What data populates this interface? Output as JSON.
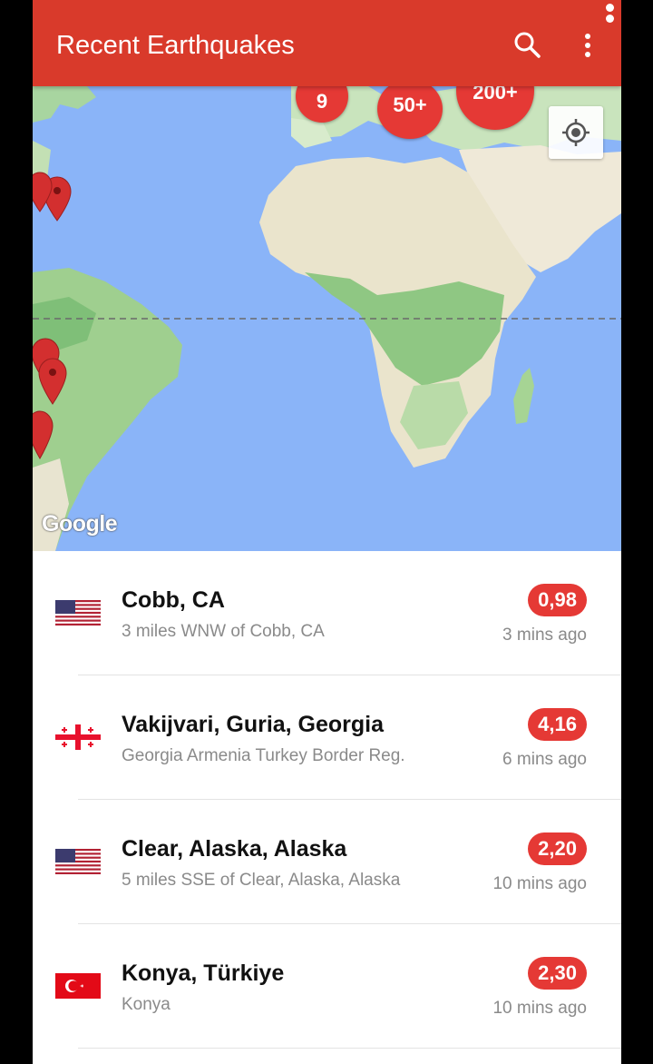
{
  "app": {
    "title": "Recent Earthquakes",
    "accent_color": "#d93a2b",
    "search_icon": "search-icon",
    "menu_icon": "more-vert-icon"
  },
  "map": {
    "attribution": "Google",
    "locate_icon": "my-location-icon",
    "clusters": [
      {
        "label": "9"
      },
      {
        "label": "50+"
      },
      {
        "label": "200+"
      }
    ]
  },
  "earthquakes": [
    {
      "place": "Cobb, CA",
      "description": "3 miles WNW of Cobb, CA",
      "magnitude": "0,98",
      "time": "3 mins ago",
      "flag": "us-flag-icon"
    },
    {
      "place": "Vakijvari, Guria, Georgia",
      "description": "Georgia Armenia Turkey Border Reg.",
      "magnitude": "4,16",
      "time": "6 mins ago",
      "flag": "georgia-flag-icon"
    },
    {
      "place": "Clear, Alaska, Alaska",
      "description": "5 miles SSE of Clear, Alaska, Alaska",
      "magnitude": "2,20",
      "time": "10 mins ago",
      "flag": "us-flag-icon"
    },
    {
      "place": "Konya, Türkiye",
      "description": "Konya",
      "magnitude": "2,30",
      "time": "10 mins ago",
      "flag": "turkey-flag-icon"
    }
  ]
}
